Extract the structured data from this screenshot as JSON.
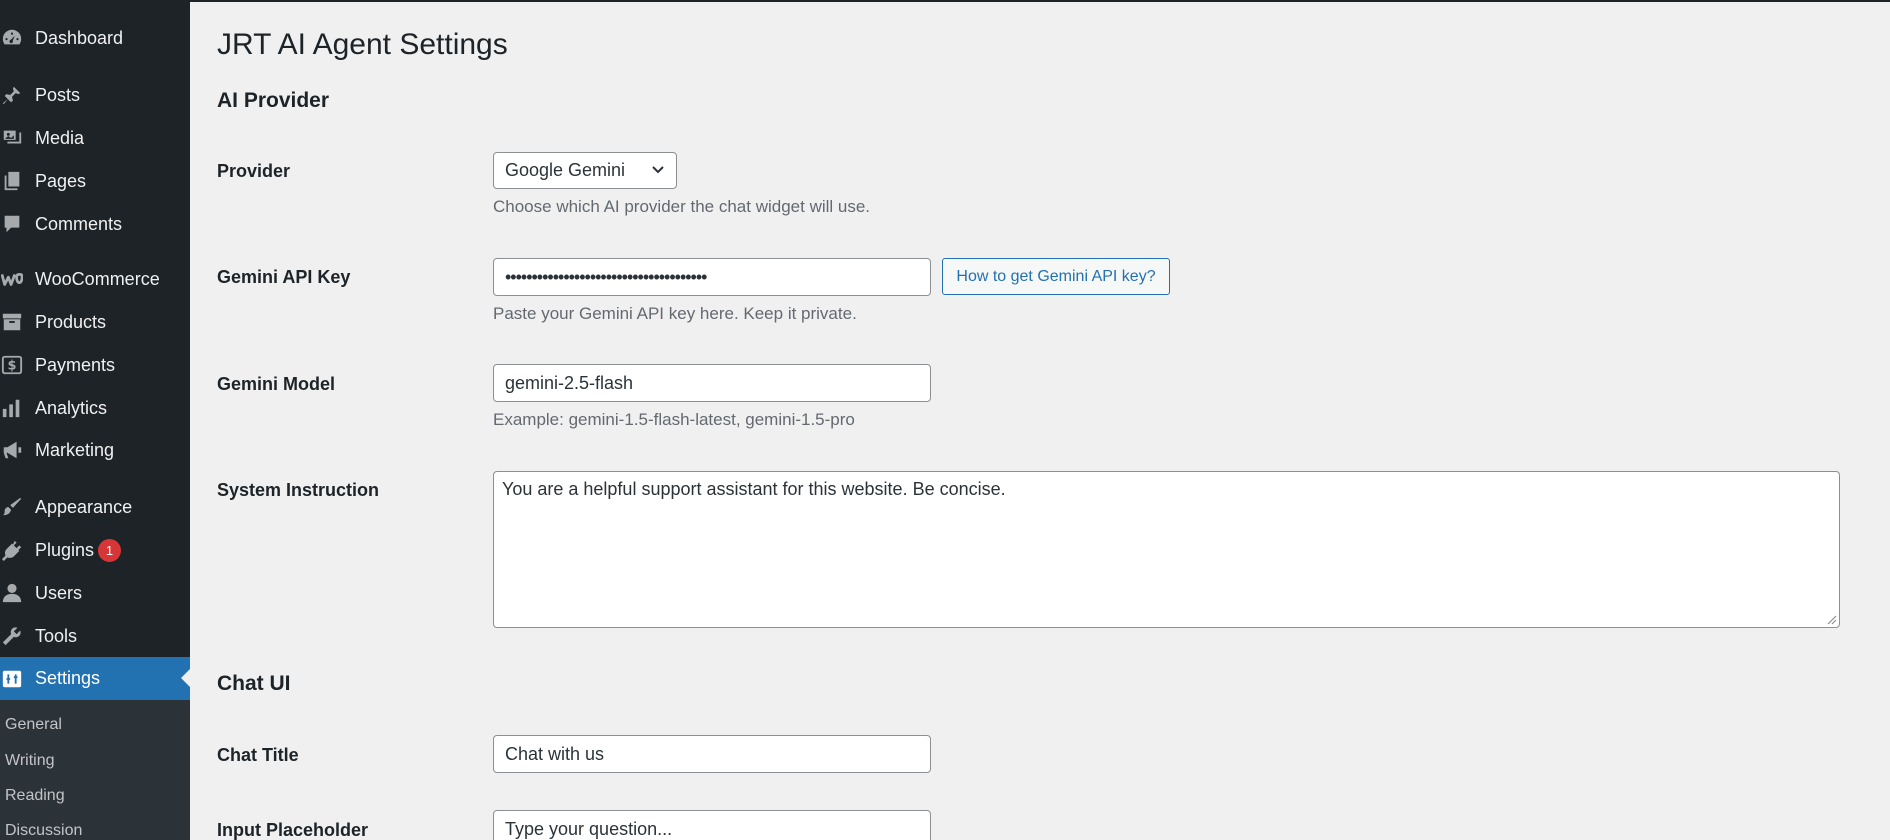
{
  "sidebar": {
    "items": [
      {
        "label": "Dashboard",
        "icon": "dashboard-icon"
      },
      {
        "label": "Posts",
        "icon": "pin-icon"
      },
      {
        "label": "Media",
        "icon": "media-icon"
      },
      {
        "label": "Pages",
        "icon": "pages-icon"
      },
      {
        "label": "Comments",
        "icon": "comment-icon"
      },
      {
        "label": "WooCommerce",
        "icon": "woocommerce-icon"
      },
      {
        "label": "Products",
        "icon": "archive-icon"
      },
      {
        "label": "Payments",
        "icon": "dollar-icon"
      },
      {
        "label": "Analytics",
        "icon": "chart-bar-icon"
      },
      {
        "label": "Marketing",
        "icon": "megaphone-icon"
      },
      {
        "label": "Appearance",
        "icon": "brush-icon"
      },
      {
        "label": "Plugins",
        "icon": "plug-icon",
        "badge": "1"
      },
      {
        "label": "Users",
        "icon": "user-icon"
      },
      {
        "label": "Tools",
        "icon": "wrench-icon"
      },
      {
        "label": "Settings",
        "icon": "settings-icon",
        "active": true
      }
    ],
    "submenu": [
      "General",
      "Writing",
      "Reading",
      "Discussion"
    ]
  },
  "page": {
    "title": "JRT AI Agent Settings",
    "sections": {
      "provider": "AI Provider",
      "chat_ui": "Chat UI"
    },
    "fields": {
      "provider": {
        "label": "Provider",
        "value": "Google Gemini",
        "description": "Choose which AI provider the chat widget will use."
      },
      "api_key": {
        "label": "Gemini API Key",
        "value": "••••••••••••••••••••••••••••••••••••••",
        "button": "How to get Gemini API key?",
        "description": "Paste your Gemini API key here. Keep it private."
      },
      "model": {
        "label": "Gemini Model",
        "value": "gemini-2.5-flash",
        "description": "Example: gemini-1.5-flash-latest, gemini-1.5-pro"
      },
      "system_instruction": {
        "label": "System Instruction",
        "value": "You are a helpful support assistant for this website. Be concise."
      },
      "chat_title": {
        "label": "Chat Title",
        "value": "Chat with us"
      },
      "input_placeholder": {
        "label": "Input Placeholder",
        "value": "Type your question..."
      }
    }
  },
  "colors": {
    "sidebar_bg": "#1d2327",
    "active_bg": "#2271b1",
    "badge": "#d63638",
    "page_bg": "#f0f0f1"
  }
}
